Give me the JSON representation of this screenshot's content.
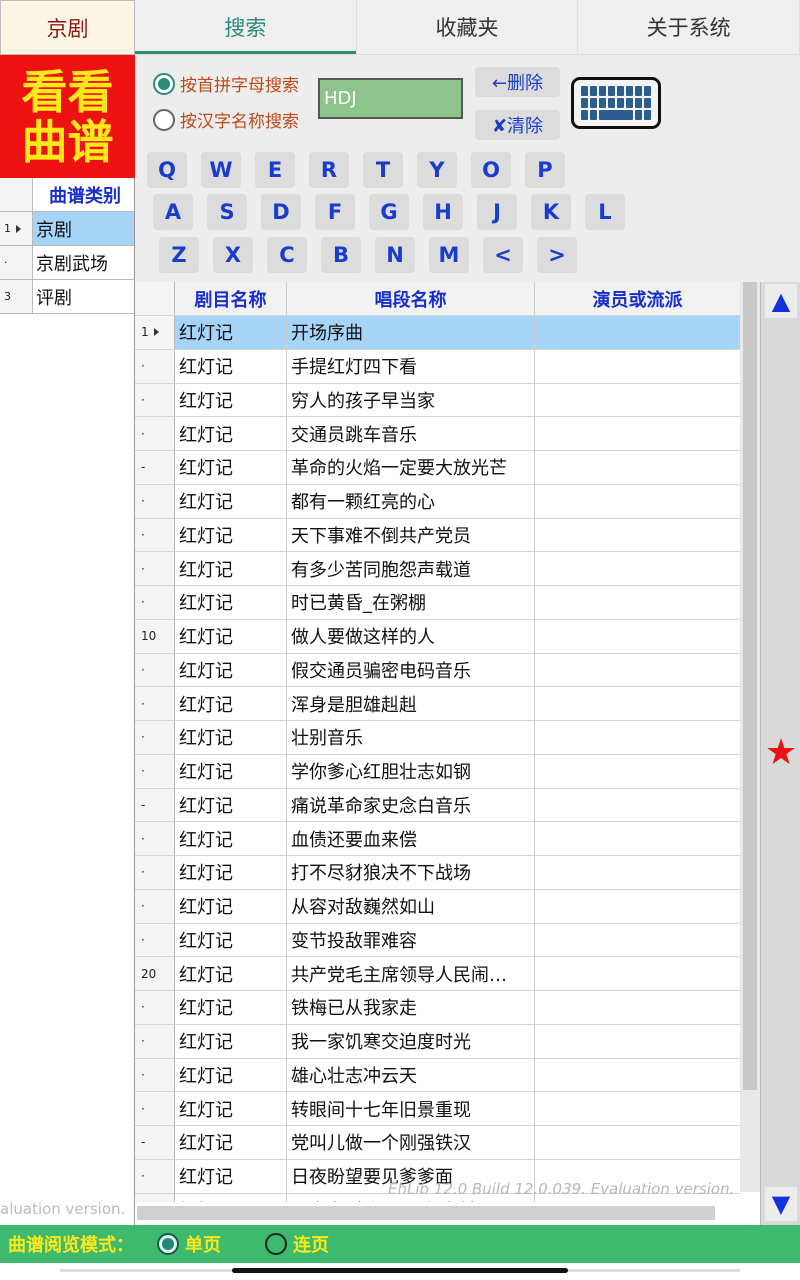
{
  "category_header": "京剧",
  "logo": {
    "line1": "看看",
    "line2": "曲谱"
  },
  "tabs": [
    {
      "label": "搜索",
      "active": true
    },
    {
      "label": "收藏夹",
      "active": false
    },
    {
      "label": "关于系统",
      "active": false
    }
  ],
  "search": {
    "mode_pinyin_label": "按首拼字母搜索",
    "mode_hanzi_label": "按汉字名称搜索",
    "selected_mode": "pinyin",
    "query_value": "HDJ",
    "delete_label": "←删除",
    "clear_label": "✘清除",
    "keyboard_icon": "keyboard-icon"
  },
  "keyboard": {
    "row1": [
      "Q",
      "W",
      "E",
      "R",
      "T",
      "Y",
      "O",
      "P"
    ],
    "row2": [
      "A",
      "S",
      "D",
      "F",
      "G",
      "H",
      "J",
      "K",
      "L"
    ],
    "row3": [
      "Z",
      "X",
      "C",
      "B",
      "N",
      "M",
      "<",
      ">"
    ]
  },
  "categories": {
    "header": "曲谱类别",
    "items": [
      {
        "index": "1",
        "label": "京剧",
        "selected": true
      },
      {
        "index": "·",
        "label": "京剧武场",
        "selected": false
      },
      {
        "index": "3",
        "label": "评剧",
        "selected": false
      }
    ]
  },
  "table": {
    "headers": [
      "剧目名称",
      "唱段名称",
      "演员或流派"
    ],
    "rows": [
      {
        "index": "1",
        "play": "红灯记",
        "aria": "开场序曲",
        "performer": "",
        "selected": true
      },
      {
        "index": "·",
        "play": "红灯记",
        "aria": "手提红灯四下看",
        "performer": ""
      },
      {
        "index": "·",
        "play": "红灯记",
        "aria": "穷人的孩子早当家",
        "performer": ""
      },
      {
        "index": "·",
        "play": "红灯记",
        "aria": "交通员跳车音乐",
        "performer": ""
      },
      {
        "index": "-",
        "play": "红灯记",
        "aria": "革命的火焰一定要大放光芒",
        "performer": ""
      },
      {
        "index": "·",
        "play": "红灯记",
        "aria": "都有一颗红亮的心",
        "performer": ""
      },
      {
        "index": "·",
        "play": "红灯记",
        "aria": "天下事难不倒共产党员",
        "performer": ""
      },
      {
        "index": "·",
        "play": "红灯记",
        "aria": "有多少苦同胞怨声载道",
        "performer": ""
      },
      {
        "index": "·",
        "play": "红灯记",
        "aria": "时已黄昏_在粥棚",
        "performer": ""
      },
      {
        "index": "10",
        "play": "红灯记",
        "aria": "做人要做这样的人",
        "performer": ""
      },
      {
        "index": "·",
        "play": "红灯记",
        "aria": "假交通员骗密电码音乐",
        "performer": ""
      },
      {
        "index": "·",
        "play": "红灯记",
        "aria": "浑身是胆雄赳赳",
        "performer": ""
      },
      {
        "index": "·",
        "play": "红灯记",
        "aria": "壮别音乐",
        "performer": ""
      },
      {
        "index": "·",
        "play": "红灯记",
        "aria": "学你爹心红胆壮志如钢",
        "performer": ""
      },
      {
        "index": "-",
        "play": "红灯记",
        "aria": "痛说革命家史念白音乐",
        "performer": ""
      },
      {
        "index": "·",
        "play": "红灯记",
        "aria": "血债还要血来偿",
        "performer": ""
      },
      {
        "index": "·",
        "play": "红灯记",
        "aria": "打不尽豺狼决不下战场",
        "performer": ""
      },
      {
        "index": "·",
        "play": "红灯记",
        "aria": "从容对敌巍然如山",
        "performer": ""
      },
      {
        "index": "·",
        "play": "红灯记",
        "aria": "变节投敌罪难容",
        "performer": ""
      },
      {
        "index": "20",
        "play": "红灯记",
        "aria": "共产党毛主席领导人民闹…",
        "performer": ""
      },
      {
        "index": "·",
        "play": "红灯记",
        "aria": "铁梅已从我家走",
        "performer": ""
      },
      {
        "index": "·",
        "play": "红灯记",
        "aria": "我一家饥寒交迫度时光",
        "performer": ""
      },
      {
        "index": "·",
        "play": "红灯记",
        "aria": "雄心壮志冲云天",
        "performer": ""
      },
      {
        "index": "·",
        "play": "红灯记",
        "aria": "转眼间十七年旧景重现",
        "performer": ""
      },
      {
        "index": "-",
        "play": "红灯记",
        "aria": "党叫儿做一个刚强铁汉",
        "performer": ""
      },
      {
        "index": "·",
        "play": "红灯记",
        "aria": "日夜盼望要见爹爹面",
        "performer": ""
      },
      {
        "index": "·",
        "play": "红灯记",
        "aria": "天亮老 光辉照儿永向前",
        "performer": ""
      }
    ]
  },
  "watermark_left": "aluation version.",
  "watermark_grid": "EhLib 12.0 Build 12.0.039. Evaluation version.",
  "view_mode": {
    "label": "曲谱阅览模式：",
    "single_page": "单页",
    "continuous": "连页",
    "selected": "single_page"
  },
  "side_buttons": {
    "up": "▲",
    "favorite": "★",
    "down": "▼"
  },
  "colors": {
    "logo_bg": "#ee1111",
    "logo_text": "#ffe81a",
    "accent_teal": "#2a8b78",
    "header_blue": "#1a2ecc",
    "selection": "#a5d4f7",
    "mode_bar": "#3dba6e"
  }
}
